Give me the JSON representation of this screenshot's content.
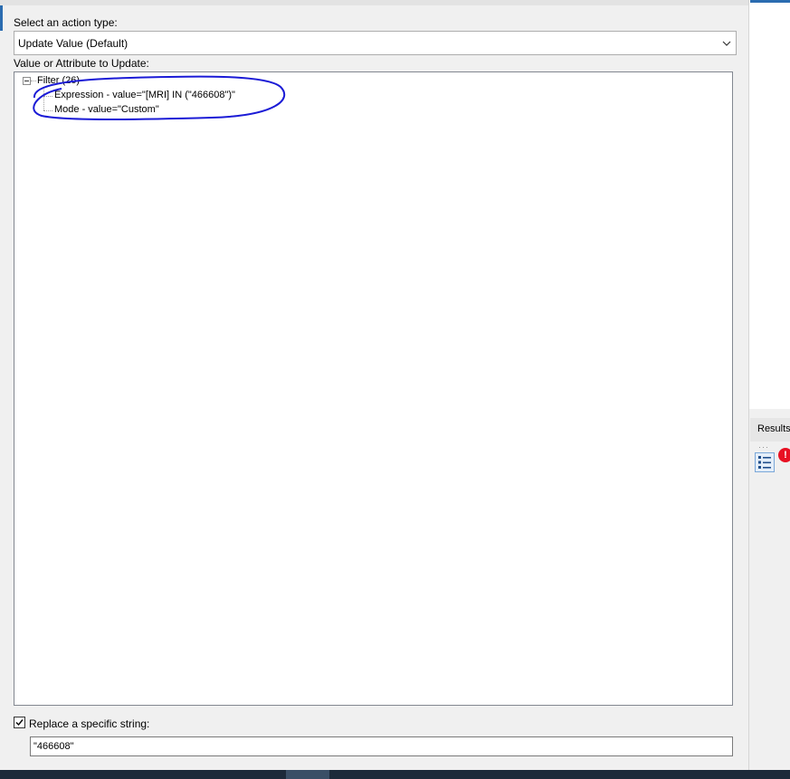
{
  "action_type": {
    "label": "Select an action type:",
    "selected": "Update Value (Default)"
  },
  "tree": {
    "label": "Value or Attribute to Update:",
    "root": "Filter (26)",
    "children": [
      "Expression - value=\"[MRI] IN (\"466608\")\"",
      "Mode - value=\"Custom\""
    ]
  },
  "replace": {
    "label": "Replace a specific string:",
    "checked": true,
    "value": "\"466608\""
  },
  "results_panel": {
    "label": "Results"
  },
  "colors": {
    "accent": "#2b6cb0",
    "annotation": "#1b1bd6",
    "error": "#e81123"
  },
  "icons": [
    "chevron-down-icon",
    "collapse-icon",
    "checkmark-icon",
    "list-icon",
    "error-icon"
  ]
}
